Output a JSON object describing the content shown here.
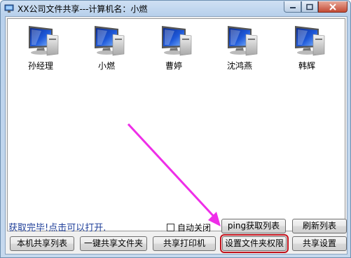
{
  "window": {
    "title": "XX公司文件共享---计算机名：小燃",
    "controls": [
      "minimize-icon",
      "maximize-icon",
      "close-icon"
    ]
  },
  "computers": [
    {
      "name": "孙经理",
      "icon": "computer-icon"
    },
    {
      "name": "小燃",
      "icon": "computer-icon"
    },
    {
      "name": "曹婷",
      "icon": "computer-icon"
    },
    {
      "name": "沈鸿燕",
      "icon": "computer-icon"
    },
    {
      "name": "韩辉",
      "icon": "computer-icon"
    }
  ],
  "status": {
    "text": "获取完毕!点击可以打开."
  },
  "auto_close": {
    "label": "自动关闭",
    "checked": false
  },
  "buttons": {
    "ping": "ping获取列表",
    "refresh": "刷新列表",
    "local_shares": "本机共享列表",
    "one_click_share": "一键共享文件夹",
    "share_printer": "共享打印机",
    "set_permissions": "设置文件夹权限",
    "share_settings": "共享设置"
  },
  "colors": {
    "annotation_arrow": "#ee2ee8",
    "highlight_box": "#c1121c",
    "status_text": "#1f3f99"
  }
}
